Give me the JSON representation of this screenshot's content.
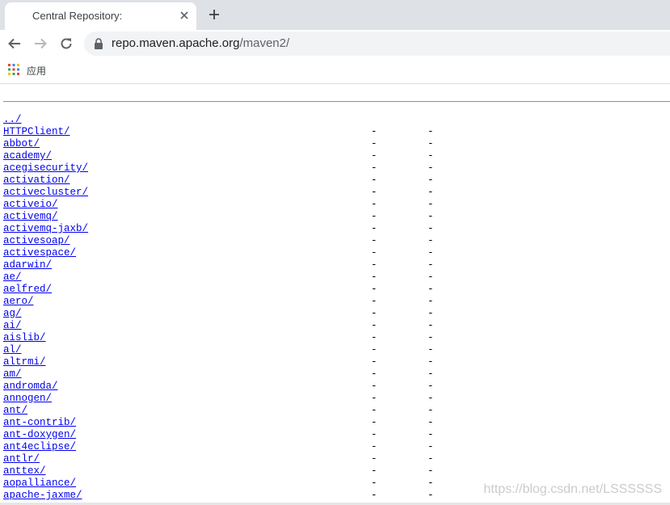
{
  "colors": {
    "tabstrip": "#dee1e6",
    "link": "#0000ee",
    "omnibox": "#f1f3f4"
  },
  "tab": {
    "title": "Central Repository:",
    "close_icon": "close-icon",
    "new_tab_icon": "plus-icon"
  },
  "toolbar": {
    "back_icon": "back-arrow-icon",
    "forward_icon": "forward-arrow-icon",
    "reload_icon": "reload-icon",
    "lock_icon": "lock-icon",
    "url_host": "repo.maven.apache.org",
    "url_path": "/maven2/"
  },
  "bookmarks": {
    "apps_label": "应用",
    "apps_icon": "apps-grid-icon"
  },
  "listing": {
    "rows": [
      {
        "name": "../",
        "date": "",
        "size": ""
      },
      {
        "name": "HTTPClient/",
        "date": "-",
        "size": "-"
      },
      {
        "name": "abbot/",
        "date": "-",
        "size": "-"
      },
      {
        "name": "academy/",
        "date": "-",
        "size": "-"
      },
      {
        "name": "acegisecurity/",
        "date": "-",
        "size": "-"
      },
      {
        "name": "activation/",
        "date": "-",
        "size": "-"
      },
      {
        "name": "activecluster/",
        "date": "-",
        "size": "-"
      },
      {
        "name": "activeio/",
        "date": "-",
        "size": "-"
      },
      {
        "name": "activemq/",
        "date": "-",
        "size": "-"
      },
      {
        "name": "activemq-jaxb/",
        "date": "-",
        "size": "-"
      },
      {
        "name": "activesoap/",
        "date": "-",
        "size": "-"
      },
      {
        "name": "activespace/",
        "date": "-",
        "size": "-"
      },
      {
        "name": "adarwin/",
        "date": "-",
        "size": "-"
      },
      {
        "name": "ae/",
        "date": "-",
        "size": "-"
      },
      {
        "name": "aelfred/",
        "date": "-",
        "size": "-"
      },
      {
        "name": "aero/",
        "date": "-",
        "size": "-"
      },
      {
        "name": "ag/",
        "date": "-",
        "size": "-"
      },
      {
        "name": "ai/",
        "date": "-",
        "size": "-"
      },
      {
        "name": "aislib/",
        "date": "-",
        "size": "-"
      },
      {
        "name": "al/",
        "date": "-",
        "size": "-"
      },
      {
        "name": "altrmi/",
        "date": "-",
        "size": "-"
      },
      {
        "name": "am/",
        "date": "-",
        "size": "-"
      },
      {
        "name": "andromda/",
        "date": "-",
        "size": "-"
      },
      {
        "name": "annogen/",
        "date": "-",
        "size": "-"
      },
      {
        "name": "ant/",
        "date": "-",
        "size": "-"
      },
      {
        "name": "ant-contrib/",
        "date": "-",
        "size": "-"
      },
      {
        "name": "ant-doxygen/",
        "date": "-",
        "size": "-"
      },
      {
        "name": "ant4eclipse/",
        "date": "-",
        "size": "-"
      },
      {
        "name": "antlr/",
        "date": "-",
        "size": "-"
      },
      {
        "name": "anttex/",
        "date": "-",
        "size": "-"
      },
      {
        "name": "aopalliance/",
        "date": "-",
        "size": "-"
      },
      {
        "name": "apache-jaxme/",
        "date": "-",
        "size": "-"
      }
    ]
  },
  "watermark": "https://blog.csdn.net/LSSSSSS"
}
